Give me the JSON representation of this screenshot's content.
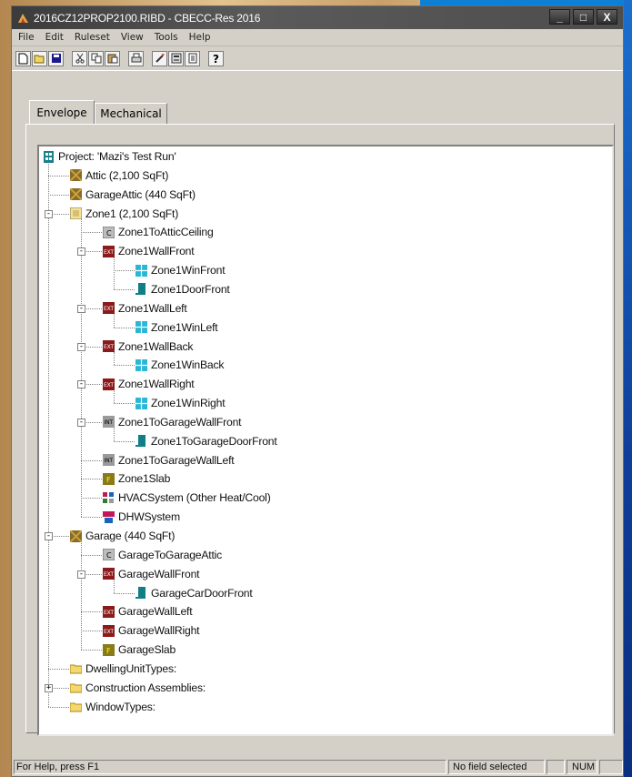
{
  "window": {
    "title": "2016CZ12PROP2100.RIBD - CBECC-Res 2016",
    "controls": [
      "minimize",
      "maximize",
      "close"
    ],
    "minimize_glyph": "_",
    "maximize_glyph": "□",
    "close_glyph": "X"
  },
  "menu": [
    "File",
    "Edit",
    "Ruleset",
    "View",
    "Tools",
    "Help"
  ],
  "toolbar": {
    "buttons": [
      "new-icon",
      "open-icon",
      "save-icon",
      "cut-icon",
      "copy-icon",
      "paste-icon",
      "print-icon",
      "wizard-icon",
      "calculator-icon",
      "report-icon",
      "help-icon"
    ]
  },
  "tabs": [
    {
      "label": "Envelope",
      "active": true
    },
    {
      "label": "Mechanical",
      "active": false
    }
  ],
  "tree": [
    {
      "label": "Project:  'Mazi's Test Run'",
      "icon": "project-icon",
      "level": 0
    },
    {
      "label": "Attic  (2,100 SqFt)",
      "icon": "attic-icon",
      "level": 1
    },
    {
      "label": "GarageAttic  (440 SqFt)",
      "icon": "attic-icon",
      "level": 1
    },
    {
      "label": "Zone1  (2,100 SqFt)",
      "icon": "zone-icon",
      "level": 1,
      "expander": "-"
    },
    {
      "label": "Zone1ToAtticCeiling",
      "icon": "ceiling-icon",
      "level": 2
    },
    {
      "label": "Zone1WallFront",
      "icon": "ext-wall-icon",
      "level": 2,
      "expander": "-"
    },
    {
      "label": "Zone1WinFront",
      "icon": "window-icon",
      "level": 3
    },
    {
      "label": "Zone1DoorFront",
      "icon": "door-icon",
      "level": 3
    },
    {
      "label": "Zone1WallLeft",
      "icon": "ext-wall-icon",
      "level": 2,
      "expander": "-"
    },
    {
      "label": "Zone1WinLeft",
      "icon": "window-icon",
      "level": 3
    },
    {
      "label": "Zone1WallBack",
      "icon": "ext-wall-icon",
      "level": 2,
      "expander": "-"
    },
    {
      "label": "Zone1WinBack",
      "icon": "window-icon",
      "level": 3
    },
    {
      "label": "Zone1WallRight",
      "icon": "ext-wall-icon",
      "level": 2,
      "expander": "-"
    },
    {
      "label": "Zone1WinRight",
      "icon": "window-icon",
      "level": 3
    },
    {
      "label": "Zone1ToGarageWallFront",
      "icon": "int-wall-icon",
      "level": 2,
      "expander": "-"
    },
    {
      "label": "Zone1ToGarageDoorFront",
      "icon": "door-icon",
      "level": 3
    },
    {
      "label": "Zone1ToGarageWallLeft",
      "icon": "int-wall-icon",
      "level": 2
    },
    {
      "label": "Zone1Slab",
      "icon": "slab-icon",
      "level": 2
    },
    {
      "label": "HVACSystem  (Other Heat/Cool)",
      "icon": "hvac-icon",
      "level": 2
    },
    {
      "label": "DHWSystem",
      "icon": "dhw-icon",
      "level": 2
    },
    {
      "label": "Garage  (440 SqFt)",
      "icon": "attic-icon",
      "level": 1,
      "expander": "-"
    },
    {
      "label": "GarageToGarageAttic",
      "icon": "ceiling-icon",
      "level": 2
    },
    {
      "label": "GarageWallFront",
      "icon": "ext-wall-icon",
      "level": 2,
      "expander": "-"
    },
    {
      "label": "GarageCarDoorFront",
      "icon": "door-icon",
      "level": 3
    },
    {
      "label": "GarageWallLeft",
      "icon": "ext-wall-icon",
      "level": 2
    },
    {
      "label": "GarageWallRight",
      "icon": "ext-wall-icon",
      "level": 2
    },
    {
      "label": "GarageSlab",
      "icon": "slab-icon",
      "level": 2
    },
    {
      "label": "DwellingUnitTypes:",
      "icon": "folder-icon",
      "level": 1
    },
    {
      "label": "Construction Assemblies:",
      "icon": "folder-icon",
      "level": 1,
      "expander": "+"
    },
    {
      "label": "WindowTypes:",
      "icon": "folder-icon",
      "level": 1
    }
  ],
  "status": {
    "help": "For Help, press F1",
    "field": "No field selected",
    "num": "NUM"
  }
}
